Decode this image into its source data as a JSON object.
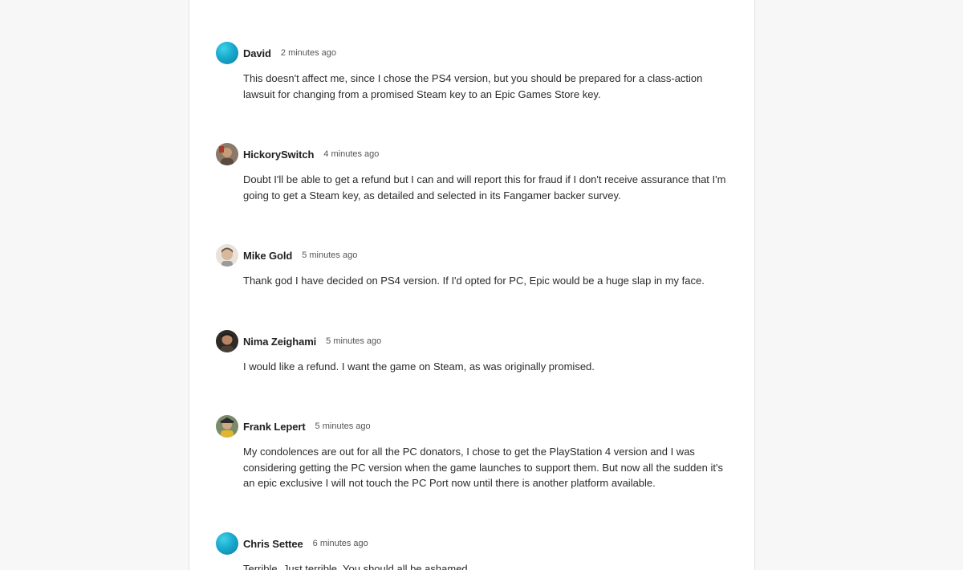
{
  "comments": [
    {
      "author": "David",
      "time": "2 minutes ago",
      "avatar": "default-avatar",
      "text": "This doesn't affect me, since I chose the PS4 version, but you should be prepared for a class-action lawsuit for changing from a promised Steam key to an Epic Games Store key."
    },
    {
      "author": "HickorySwitch",
      "time": "4 minutes ago",
      "avatar": "user-photo",
      "text": "Doubt I'll be able to get a refund but I can and will report this for fraud if I don't receive assurance that I'm going to get a Steam key, as detailed and selected in its Fangamer backer survey."
    },
    {
      "author": "Mike Gold",
      "time": "5 minutes ago",
      "avatar": "user-photo",
      "text": "Thank god I have decided on PS4 version. If I'd opted for PC, Epic would be a huge slap in my face."
    },
    {
      "author": "Nima Zeighami",
      "time": "5 minutes ago",
      "avatar": "user-photo",
      "text": "I would like a refund. I want the game on Steam, as was originally promised."
    },
    {
      "author": "Frank Lepert",
      "time": "5 minutes ago",
      "avatar": "user-photo",
      "text": "My condolences are out for all the PC donators, I chose to get the PlayStation 4 version and I was considering getting the PC version when the game launches to support them. But now all the sudden it's an epic exclusive I will not touch the PC Port now until there is another platform available."
    },
    {
      "author": "Chris Settee",
      "time": "6 minutes ago",
      "avatar": "default-avatar",
      "text": "Terrible. Just terrible. You should all be ashamed."
    }
  ]
}
